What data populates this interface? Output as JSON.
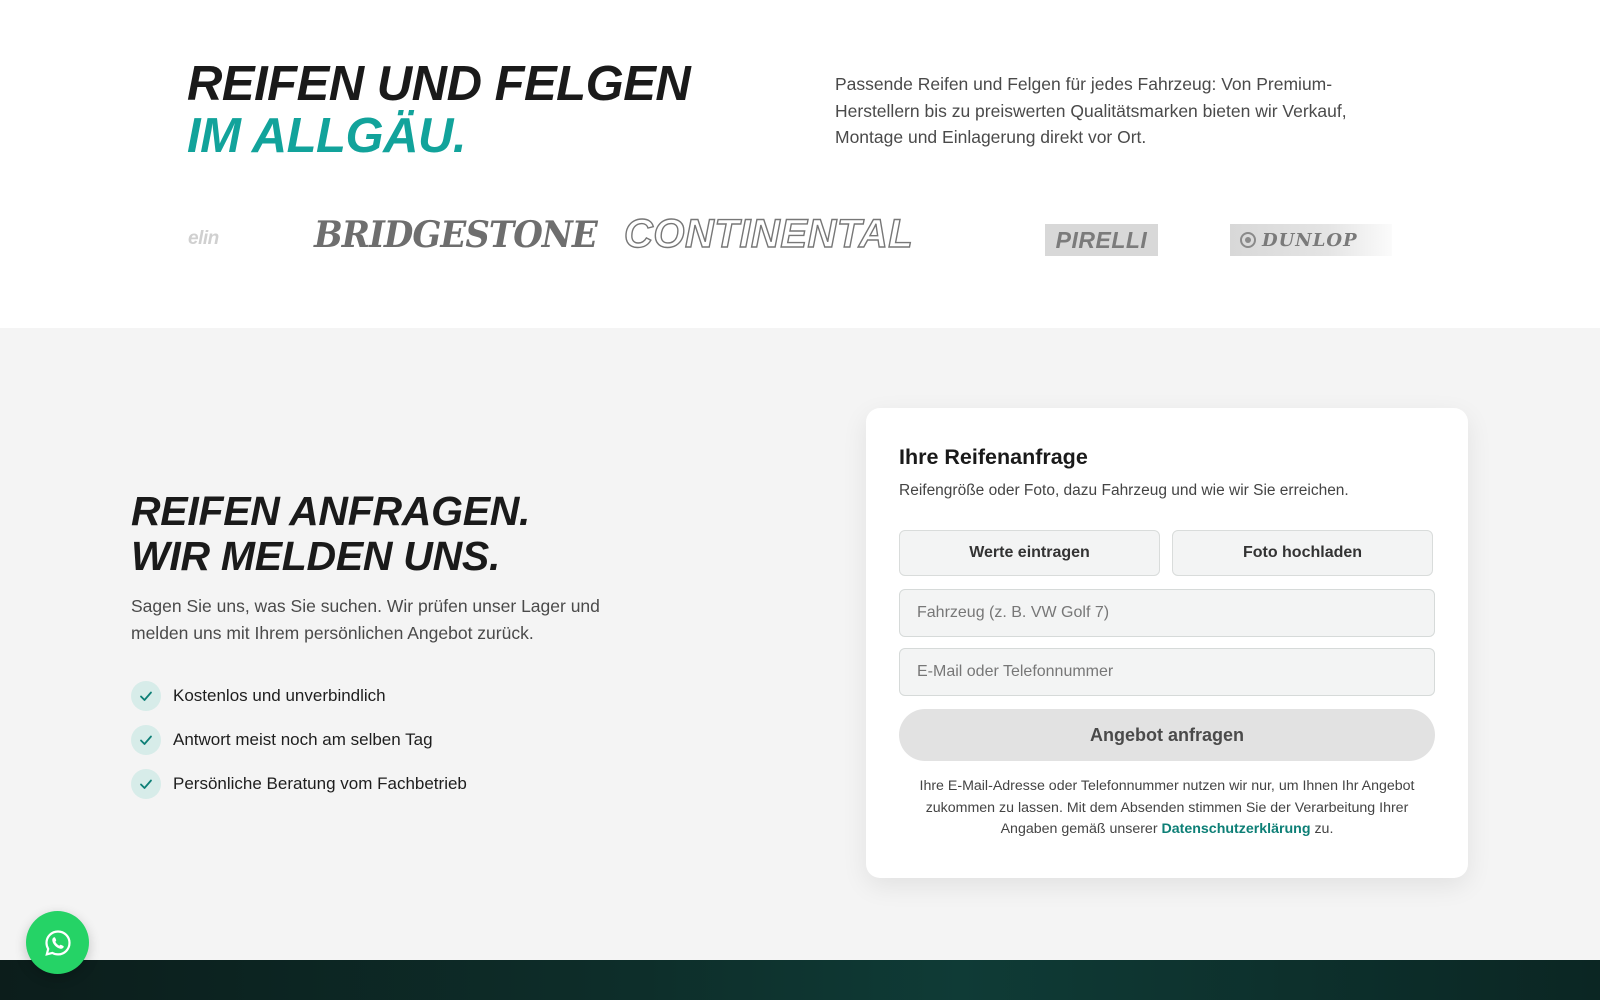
{
  "hero": {
    "title_line1": "REIFEN UND FELGEN",
    "title_line2": "IM ALLGÄU.",
    "text": "Passende Reifen und Felgen für jedes Fahrzeug: Von Premium-Herstellern bis zu preiswerten Qualitätsmarken bieten wir Verkauf, Montage und Einlagerung direkt vor Ort."
  },
  "brands": {
    "michelin": "elin",
    "bridgestone": "BRIDGESTONE",
    "continental": "CONTINENTAL",
    "pirelli": "PIRELLI",
    "dunlop": "DUNLOP"
  },
  "inquiry": {
    "title_line1": "REIFEN ANFRAGEN.",
    "title_line2": "WIR MELDEN UNS.",
    "text": "Sagen Sie uns, was Sie suchen. Wir prüfen unser Lager und melden uns mit Ihrem persönlichen Angebot zurück.",
    "benefits": [
      "Kostenlos und unverbindlich",
      "Antwort meist noch am selben Tag",
      "Persönliche Beratung vom Fachbetrieb"
    ]
  },
  "form": {
    "title": "Ihre Reifenanfrage",
    "subtitle": "Reifengröße oder Foto, dazu Fahrzeug und wie wir Sie erreichen.",
    "tab_values": "Werte eintragen",
    "tab_photo": "Foto hochladen",
    "vehicle_placeholder": "Fahrzeug (z. B. VW Golf 7)",
    "contact_placeholder": "E-Mail oder Telefonnummer",
    "submit_label": "Angebot anfragen",
    "privacy_before": "Ihre E-Mail-Adresse oder Telefonnummer nutzen wir nur, um Ihnen Ihr Angebot zukommen zu lassen. Mit dem Absenden stimmen Sie der Verarbeitung Ihrer Angaben gemäß unserer ",
    "privacy_link": "Datenschutzerklärung",
    "privacy_after": " zu."
  },
  "colors": {
    "accent": "#12a39b",
    "link": "#0d7f76",
    "whatsapp": "#25d366"
  },
  "icons": {
    "check": "check-icon",
    "whatsapp": "whatsapp-icon"
  }
}
